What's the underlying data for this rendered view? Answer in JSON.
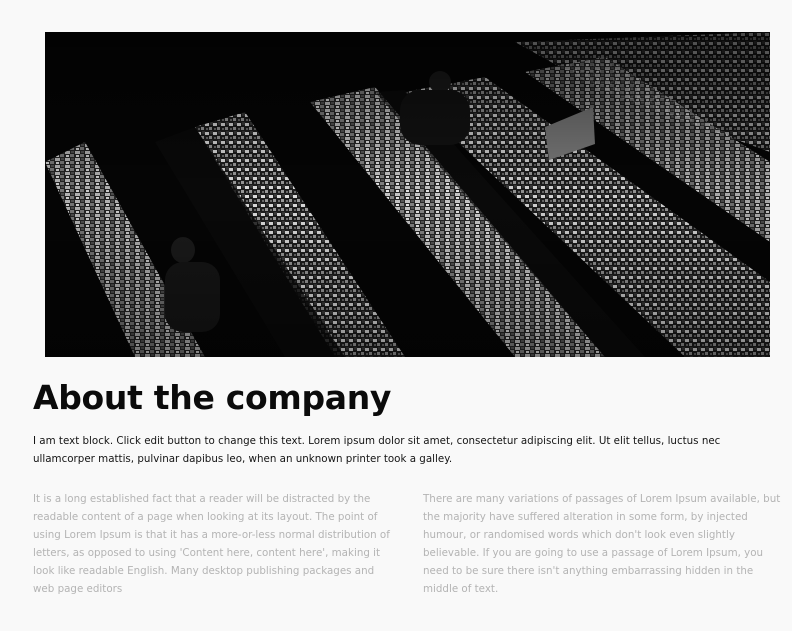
{
  "hero": {
    "alt": "Black and white photo of a bookstore with long tables of stacked books and people browsing"
  },
  "about": {
    "title": "About the company",
    "lead": "I am text block. Click edit button to change this text. Lorem ipsum dolor sit amet, consectetur adipiscing elit. Ut elit tellus, luctus nec ullamcorper mattis, pulvinar dapibus leo, when an unknown printer took a galley.",
    "column_left": "It is a long established fact that a reader will be distracted by the readable content of a page when looking at its layout. The point of using Lorem Ipsum is that it has a more-or-less normal distribution of letters, as opposed to using 'Content here, content here', making it look like readable English. Many desktop publishing packages and web page editors",
    "column_right": "There are many variations of passages of Lorem Ipsum available, but the majority have suffered alteration in some form, by injected humour, or randomised words which don't look even slightly believable. If you are going to use a passage of Lorem Ipsum, you need to be sure there isn't anything embarrassing hidden in the middle of text."
  },
  "colors": {
    "background": "#f9f9f9",
    "heading": "#0b0b0b",
    "body_text": "#151515",
    "muted_text": "#b4b4b4"
  }
}
